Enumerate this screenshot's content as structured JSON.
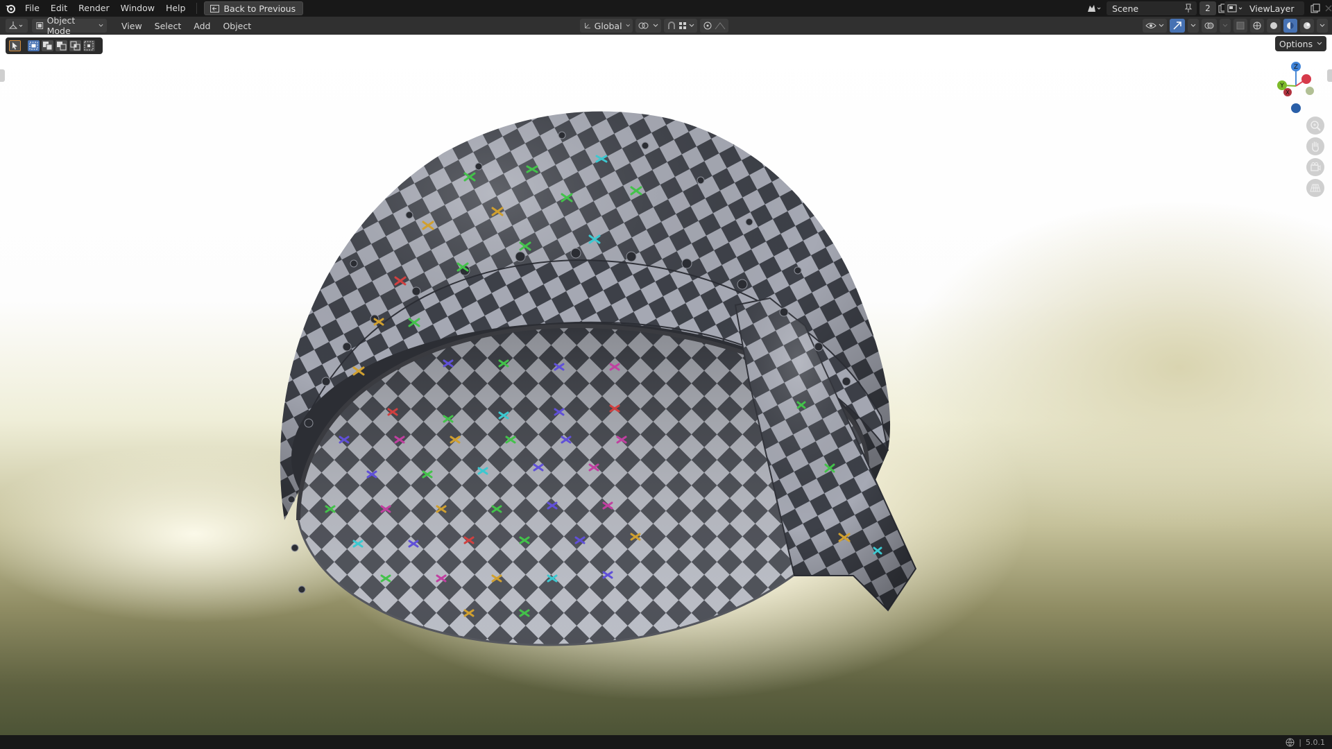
{
  "menu": {
    "items": [
      "File",
      "Edit",
      "Render",
      "Window",
      "Help"
    ],
    "back_button": "Back to Previous"
  },
  "scene": {
    "name": "Scene",
    "count": "2"
  },
  "view_layer": {
    "name": "ViewLayer"
  },
  "header": {
    "mode": "Object Mode",
    "menus": [
      "View",
      "Select",
      "Add",
      "Object"
    ],
    "orientation": "Global"
  },
  "viewport": {
    "options_label": "Options"
  },
  "gizmo": {
    "z_label": "Z",
    "y_label": "Y",
    "x_label": "X"
  },
  "status": {
    "version": "5.0.1"
  },
  "colors": {
    "accent": "#4772b3",
    "active_tool_outline": "#d68d3a"
  }
}
